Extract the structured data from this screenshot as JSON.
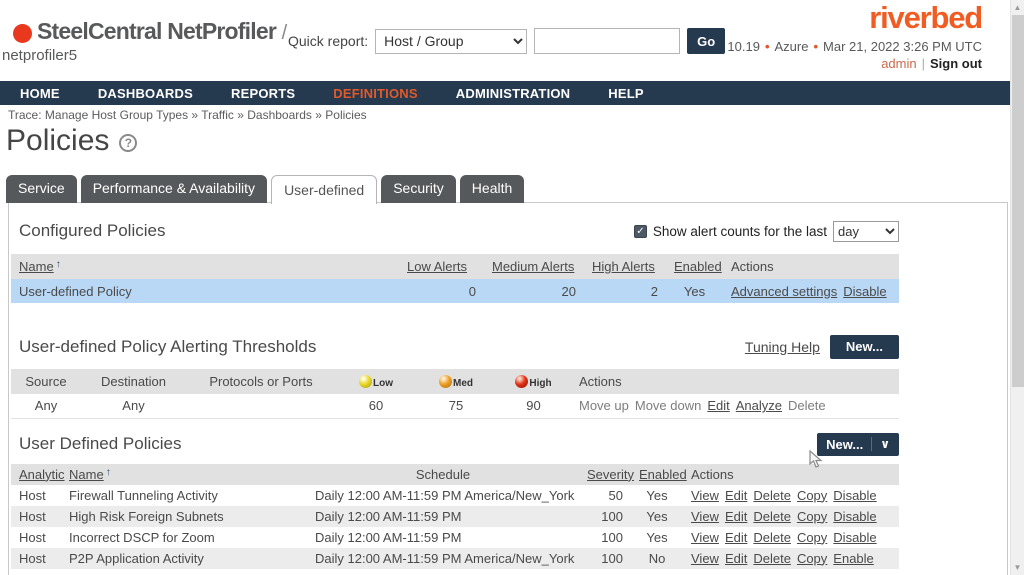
{
  "icons": {
    "help": "?",
    "sort_asc": "↑",
    "bullet": "•",
    "check": "✓",
    "divider": "|",
    "chevron_down": "∨",
    "scroll_up": "▲",
    "scroll_down": "▼"
  },
  "colors": {
    "navy": "#25394f",
    "nav_active_orange": "#e0592a",
    "brand_orange": "#f15c22",
    "logo_red": "#e8391f",
    "selected_row_blue": "#b9d8f6",
    "table_header_gray": "#e1e1e1",
    "alt_row_gray": "#ececec",
    "severity_low": "#e8d82a",
    "severity_med": "#eda029",
    "severity_high": "#e03418"
  },
  "header": {
    "product": "SteelCentral NetProfiler",
    "product_suffix": "/",
    "hostname": "netprofiler5",
    "quick_report_label": "Quick report:",
    "quick_report_value": "Host / Group",
    "search_value": "",
    "go_label": "Go",
    "brand": "riverbed",
    "version": "10.19",
    "platform": "Azure",
    "datetime": "Mar 21, 2022 3:26 PM UTC",
    "user": "admin",
    "sign_out": "Sign out"
  },
  "nav": {
    "items": [
      "HOME",
      "DASHBOARDS",
      "REPORTS",
      "DEFINITIONS",
      "ADMINISTRATION",
      "HELP"
    ],
    "active_item": "DEFINITIONS"
  },
  "breadcrumb": "Trace: Manage Host Group Types » Traffic » Dashboards » Policies",
  "page": {
    "title": "Policies"
  },
  "tabs": {
    "items": [
      "Service",
      "Performance & Availability",
      "User-defined",
      "Security",
      "Health"
    ],
    "active": "User-defined"
  },
  "configured": {
    "heading": "Configured Policies",
    "filter": {
      "checked": true,
      "label": "Show alert counts for the last",
      "period_value": "day"
    },
    "table": {
      "columns": [
        "Name",
        "Low Alerts",
        "Medium Alerts",
        "High Alerts",
        "Enabled",
        "Actions"
      ],
      "row": {
        "name": "User-defined Policy",
        "low_alerts": "0",
        "medium_alerts": "20",
        "high_alerts": "2",
        "enabled": "Yes",
        "actions": [
          "Advanced settings",
          "Disable"
        ]
      }
    }
  },
  "thresholds": {
    "heading": "User-defined Policy Alerting Thresholds",
    "tuning_help_label": "Tuning Help",
    "new_button_label": "New...",
    "table": {
      "columns": [
        "Source",
        "Destination",
        "Protocols or Ports"
      ],
      "severity_columns": [
        {
          "level": "low",
          "label": "Low"
        },
        {
          "level": "med",
          "label": "Med"
        },
        {
          "level": "high",
          "label": "High"
        }
      ],
      "actions_column": "Actions",
      "row": {
        "source": "Any",
        "destination": "Any",
        "protocols_or_ports": "",
        "low": "60",
        "med": "75",
        "high": "90",
        "actions": [
          {
            "label": "Move up",
            "enabled": false
          },
          {
            "label": "Move down",
            "enabled": false
          },
          {
            "label": "Edit",
            "enabled": true
          },
          {
            "label": "Analyze",
            "enabled": true
          },
          {
            "label": "Delete",
            "enabled": false
          }
        ]
      }
    }
  },
  "user_defined": {
    "heading": "User Defined Policies",
    "new_button_label": "New...",
    "table": {
      "columns": {
        "analytic": "Analytic",
        "name": "Name",
        "schedule": "Schedule",
        "severity": "Severity",
        "enabled": "Enabled",
        "actions": "Actions"
      },
      "rows": [
        {
          "analytic": "Host",
          "name": "Firewall Tunneling Activity",
          "schedule": "Daily 12:00 AM-11:59 PM America/New_York",
          "severity": "50",
          "enabled": "Yes",
          "actions": [
            "View",
            "Edit",
            "Delete",
            "Copy",
            "Disable"
          ]
        },
        {
          "analytic": "Host",
          "name": "High Risk Foreign Subnets",
          "schedule": "Daily 12:00 AM-11:59 PM",
          "severity": "100",
          "enabled": "Yes",
          "actions": [
            "View",
            "Edit",
            "Delete",
            "Copy",
            "Disable"
          ]
        },
        {
          "analytic": "Host",
          "name": "Incorrect DSCP for Zoom",
          "schedule": "Daily 12:00 AM-11:59 PM",
          "severity": "100",
          "enabled": "Yes",
          "actions": [
            "View",
            "Edit",
            "Delete",
            "Copy",
            "Disable"
          ]
        },
        {
          "analytic": "Host",
          "name": "P2P Application Activity",
          "schedule": "Daily 12:00 AM-11:59 PM America/New_York",
          "severity": "100",
          "enabled": "No",
          "actions": [
            "View",
            "Edit",
            "Delete",
            "Copy",
            "Enable"
          ]
        }
      ]
    }
  }
}
